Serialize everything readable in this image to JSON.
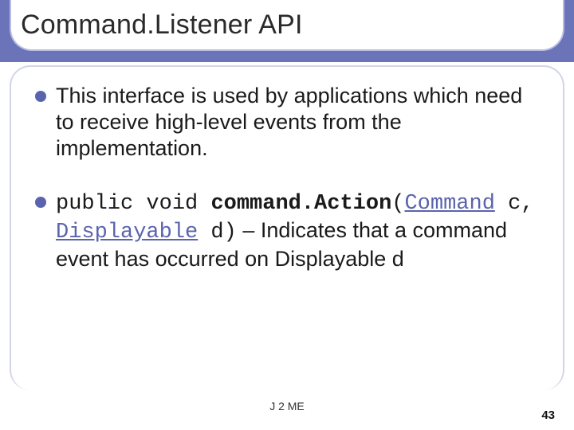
{
  "title": "Command.Listener API",
  "bullets": [
    {
      "segments": [
        {
          "text": "This interface is used by applications which need to receive high-level events from the implementation."
        }
      ]
    },
    {
      "segments": [
        {
          "text": "public void ",
          "mono": true
        },
        {
          "text": "command.Action",
          "mono": true,
          "bold": true
        },
        {
          "text": "(",
          "mono": true
        },
        {
          "text": "Command",
          "mono": true,
          "link": true
        },
        {
          "text": " c, ",
          "mono": true
        },
        {
          "text": "Displayable",
          "mono": true,
          "link": true
        },
        {
          "text": " d)",
          "mono": true
        },
        {
          "text": " – "
        },
        {
          "text": " Indicates that a command event has occurred on Displayable d"
        }
      ]
    }
  ],
  "footer": {
    "center": "J 2 ME",
    "page": "43"
  }
}
